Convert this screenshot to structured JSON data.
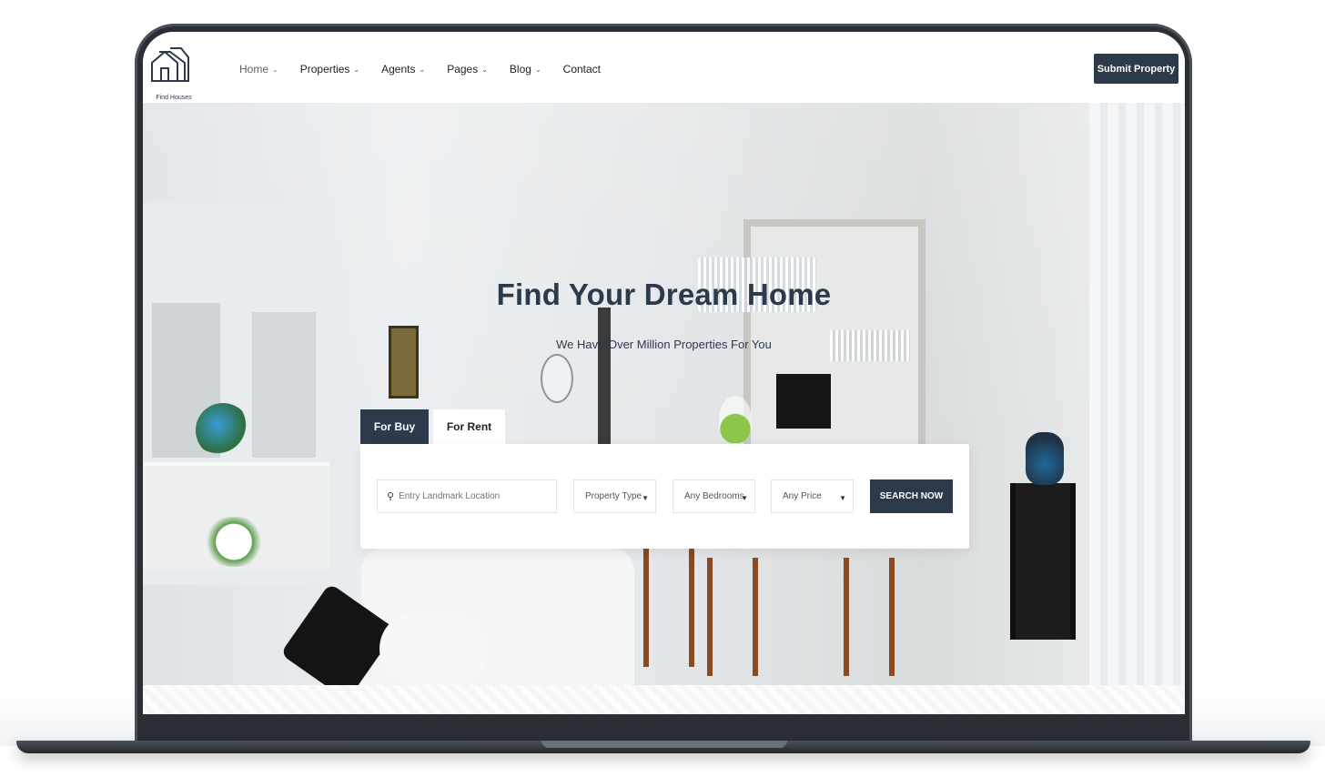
{
  "brand": {
    "name": "Find Houses"
  },
  "nav": {
    "items": [
      {
        "label": "Home",
        "has_dropdown": true,
        "active": true
      },
      {
        "label": "Properties",
        "has_dropdown": true
      },
      {
        "label": "Agents",
        "has_dropdown": true
      },
      {
        "label": "Pages",
        "has_dropdown": true
      },
      {
        "label": "Blog",
        "has_dropdown": true
      },
      {
        "label": "Contact",
        "has_dropdown": false
      }
    ],
    "cta_label": "Submit Property"
  },
  "hero": {
    "title": "Find Your Dream Home",
    "subtitle": "We Have Over Million Properties For You"
  },
  "search": {
    "tabs": [
      {
        "label": "For Buy",
        "selected": false
      },
      {
        "label": "For Rent",
        "selected": true
      }
    ],
    "location_placeholder": "Entry Landmark Location",
    "property_type": "Property Type",
    "bedrooms": "Any Bedrooms",
    "price": "Any Price",
    "button_label": "SEARCH NOW"
  },
  "colors": {
    "primary": "#2d3a4b",
    "background": "#ffffff",
    "device_frame": "#2a2f35"
  },
  "icons": {
    "logo": "house-outline-icon",
    "location": "map-pin-icon",
    "dropdown": "caret-down-icon",
    "nav_dropdown": "chevron-down-icon"
  }
}
